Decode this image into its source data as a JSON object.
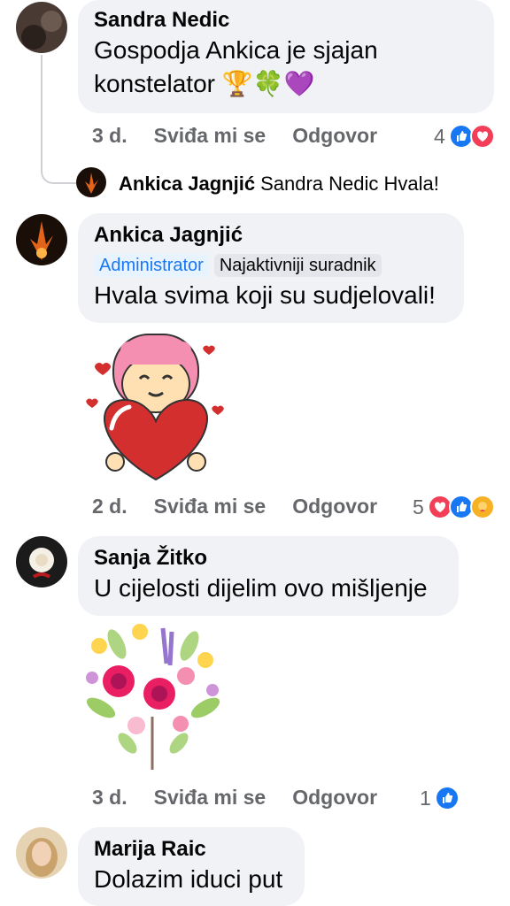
{
  "comments": [
    {
      "author": "Sandra Nedic",
      "text": "Gospodja  Ankica je sjajan",
      "text2": "konstelator 🏆🍀💜",
      "time": "3 d.",
      "like": "Sviđa mi se",
      "reply": "Odgovor",
      "reactions": "4",
      "reply_preview": {
        "author": "Ankica Jagnjić",
        "text": "Sandra Nedic Hvala!"
      }
    },
    {
      "author": "Ankica Jagnjić",
      "badges": [
        "Administrator",
        "Najaktivniji suradnik"
      ],
      "text": "Hvala svima koji su sudjelovali!",
      "sticker": "girl-heart-sticker",
      "time": "2 d.",
      "like": "Sviđa mi se",
      "reply": "Odgovor",
      "reactions": "5"
    },
    {
      "author": "Sanja Žitko",
      "text": "U cijelosti dijelim ovo mišljenje",
      "sticker": "flower-heart-sticker",
      "time": "3 d.",
      "like": "Sviđa mi se",
      "reply": "Odgovor",
      "reactions": "1"
    },
    {
      "author": "Marija Raic",
      "text": "Dolazim iduci put"
    }
  ],
  "colors": {
    "like": "#1877f2",
    "love": "#f33e58",
    "care": "#f7b125",
    "bubble": "#f0f2f5",
    "meta": "#65676b"
  }
}
